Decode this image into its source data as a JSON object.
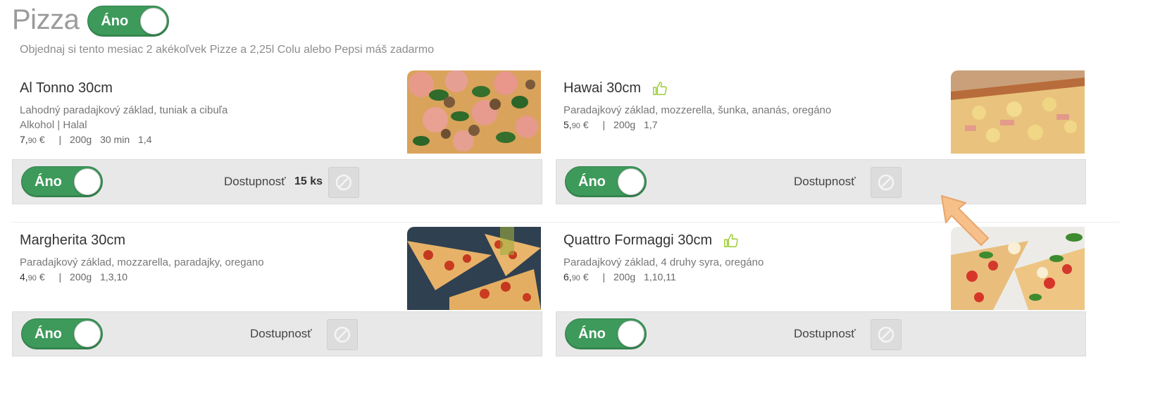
{
  "header": {
    "title": "Pizza",
    "toggle_label": "Áno",
    "promo": "Objednaj si tento mesiac 2 akékoľvek Pizze a 2,25l Colu alebo Pepsi máš zadarmo"
  },
  "colors": {
    "toggle_on": "#3d9a5b",
    "like_icon": "#9acd32",
    "arrow": "#f7c08a"
  },
  "availability_label": "Dostupnosť",
  "items": [
    {
      "name": "Al Tonno 30cm",
      "liked": false,
      "description": "Lahodný paradajkový základ, tuniak a cibuľa",
      "tags": "Alkohol | Halal",
      "price_main": "7,",
      "price_cents": "90",
      "currency": "€",
      "weight": "200g",
      "time": "30 min",
      "allergens": "1,4",
      "toggle_label": "Áno",
      "quantity": "15 ks",
      "photo_icon": "pizza-tuna-photo"
    },
    {
      "name": "Hawai 30cm",
      "liked": true,
      "description": "Paradajkový základ, mozzerella, šunka, ananás, oregáno",
      "tags": "",
      "price_main": "5,",
      "price_cents": "90",
      "currency": "€",
      "weight": "200g",
      "time": "",
      "allergens": "1,7",
      "toggle_label": "Áno",
      "quantity": "",
      "photo_icon": "pizza-hawai-photo"
    },
    {
      "name": "Margherita 30cm",
      "liked": false,
      "description": "Paradajkový základ, mozzarella, paradajky, oregano",
      "tags": "",
      "price_main": "4,",
      "price_cents": "90",
      "currency": "€",
      "weight": "200g",
      "time": "",
      "allergens": "1,3,10",
      "toggle_label": "Áno",
      "quantity": "",
      "photo_icon": "pizza-pepperoni-photo"
    },
    {
      "name": "Quattro Formaggi 30cm",
      "liked": true,
      "description": "Paradajkový základ, 4 druhy syra, oregáno",
      "tags": "",
      "price_main": "6,",
      "price_cents": "90",
      "currency": "€",
      "weight": "200g",
      "time": "",
      "allergens": "1,10,11",
      "toggle_label": "Áno",
      "quantity": "",
      "photo_icon": "pizza-formaggi-photo"
    }
  ]
}
